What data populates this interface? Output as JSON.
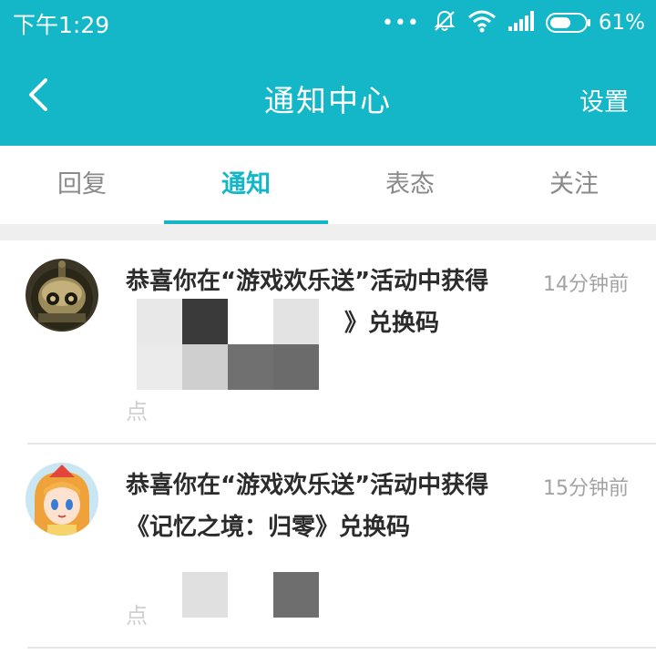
{
  "status_bar": {
    "time": "下午1:29",
    "dots": "•••",
    "battery_percent": "61%",
    "battery_level": 0.61
  },
  "header": {
    "title": "通知中心",
    "settings_label": "设置"
  },
  "tabs": [
    {
      "label": "回复",
      "active": false
    },
    {
      "label": "通知",
      "active": true
    },
    {
      "label": "表态",
      "active": false
    },
    {
      "label": "关注",
      "active": false
    }
  ],
  "notifications": [
    {
      "line1": "恭喜你在“游戏欢乐送”活动中获得",
      "line2": "》兑换码",
      "time": "14分钟前",
      "faded_text": "点"
    },
    {
      "line1": "恭喜你在“游戏欢乐送”活动中获得",
      "line2": "《记忆之境：归零》兑换码",
      "time": "15分钟前",
      "faded_text": "点"
    }
  ],
  "colors": {
    "accent": "#14b7c7",
    "text": "#2b2b2b",
    "muted": "#a3a3a3"
  }
}
